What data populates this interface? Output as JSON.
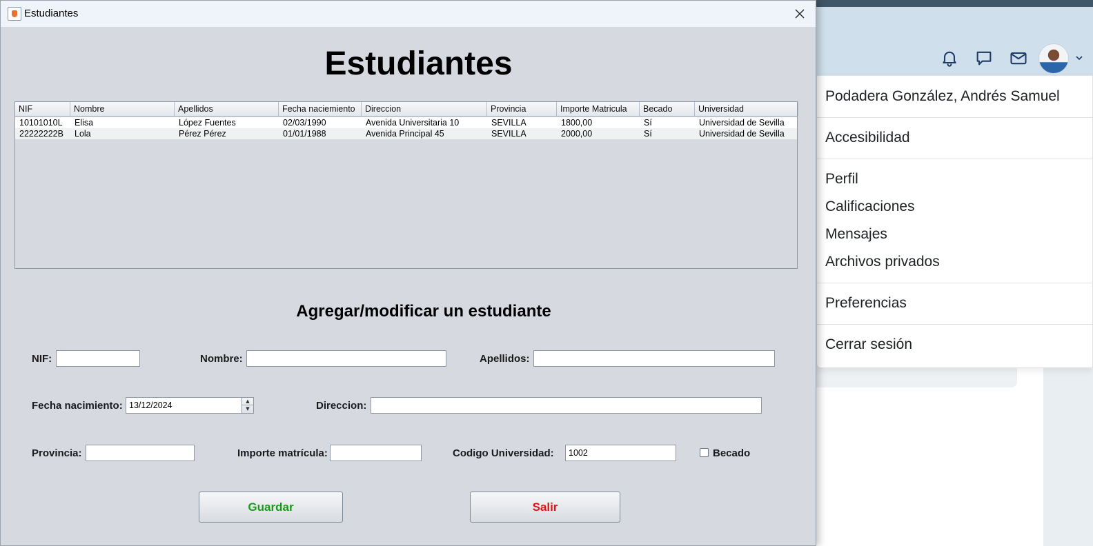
{
  "window": {
    "title": "Estudiantes",
    "heading": "Estudiantes",
    "subheading": "Agregar/modificar un estudiante"
  },
  "table": {
    "columns": [
      "NIF",
      "Nombre",
      "Apellidos",
      "Fecha naciemiento",
      "Direccion",
      "Provincia",
      "Importe Matricula",
      "Becado",
      "Universidad"
    ],
    "rows": [
      [
        "10101010L",
        "Elisa",
        "López Fuentes",
        "02/03/1990",
        "Avenida Universitaria 10",
        "SEVILLA",
        "1800,00",
        "Sí",
        "Universidad de Sevilla"
      ],
      [
        "22222222B",
        "Lola",
        "Pérez Pérez",
        "01/01/1988",
        "Avenida Principal 45",
        "SEVILLA",
        "2000,00",
        "Sí",
        "Universidad de Sevilla"
      ]
    ]
  },
  "form": {
    "nif_label": "NIF:",
    "nif_value": "",
    "nombre_label": "Nombre:",
    "nombre_value": "",
    "apellidos_label": "Apellidos:",
    "apellidos_value": "",
    "fecha_label": "Fecha nacimiento:",
    "fecha_value": "13/12/2024",
    "direccion_label": "Direccion:",
    "direccion_value": "",
    "provincia_label": "Provincia:",
    "provincia_value": "",
    "importe_label": "Importe matrícula:",
    "importe_value": "",
    "codigo_label": "Codigo Universidad:",
    "codigo_value": "1002",
    "becado_label": "Becado",
    "becado_checked": false
  },
  "buttons": {
    "save": "Guardar",
    "exit": "Salir"
  },
  "user_menu": {
    "user_name": "Podadera González, Andrés Samuel",
    "items": [
      "Accesibilidad",
      "Perfil",
      "Calificaciones",
      "Mensajes",
      "Archivos privados",
      "Preferencias",
      "Cerrar sesión"
    ]
  },
  "icons": [
    "bell-icon",
    "chat-icon",
    "mail-icon",
    "avatar",
    "chevron-down-icon",
    "java-app-icon",
    "close-icon"
  ],
  "colors": {
    "save_text": "#1a9a1a",
    "exit_text": "#e01414",
    "window_bg": "#d6d9e0"
  }
}
